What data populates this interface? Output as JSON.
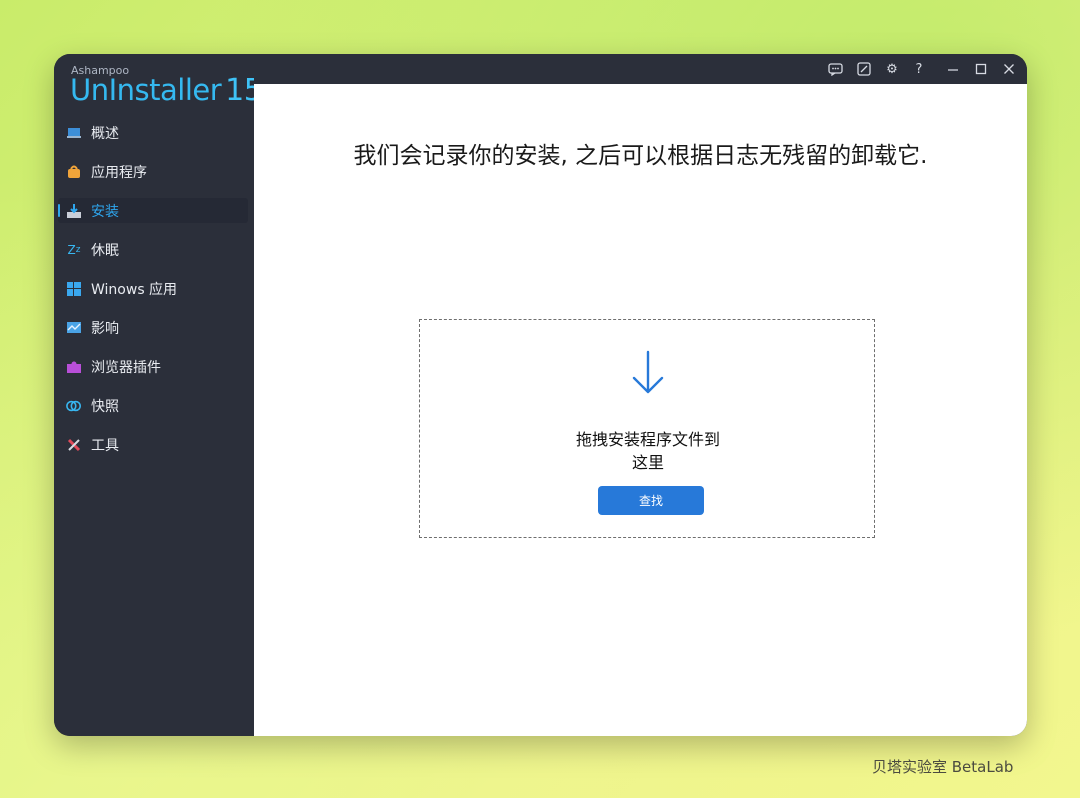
{
  "brand": {
    "vendor": "Ashampoo",
    "product": "UnInstaller",
    "version": "15"
  },
  "sidebar": {
    "items": [
      {
        "label": "概述",
        "icon": "laptop-icon",
        "active": false
      },
      {
        "label": "应用程序",
        "icon": "package-icon",
        "active": false
      },
      {
        "label": "安装",
        "icon": "install-tray-icon",
        "active": true
      },
      {
        "label": "休眠",
        "icon": "sleep-zz-icon",
        "active": false
      },
      {
        "label": "Winows 应用",
        "icon": "windows-logo-icon",
        "active": false
      },
      {
        "label": "影响",
        "icon": "chart-monitor-icon",
        "active": false
      },
      {
        "label": "浏览器插件",
        "icon": "puzzle-icon",
        "active": false
      },
      {
        "label": "快照",
        "icon": "snapshot-rings-icon",
        "active": false
      },
      {
        "label": "工具",
        "icon": "tools-icon",
        "active": false
      }
    ]
  },
  "titlebar": {
    "buttons": [
      "feedback-icon",
      "edit-note-icon",
      "gear-icon",
      "help-icon",
      "minimize-icon",
      "maximize-icon",
      "close-icon"
    ],
    "help_glyph": "?"
  },
  "main": {
    "headline": "我们会记录你的安装, 之后可以根据日志无残留的卸载它.",
    "drop_text_line1": "拖拽安装程序文件到",
    "drop_text_line2": "这里",
    "find_button": "查找"
  },
  "watermark": "贝塔实验室 BetaLab",
  "colors": {
    "accent": "#2ea6ee",
    "button": "#2779d9",
    "sidebar": "#2b2f3a"
  }
}
